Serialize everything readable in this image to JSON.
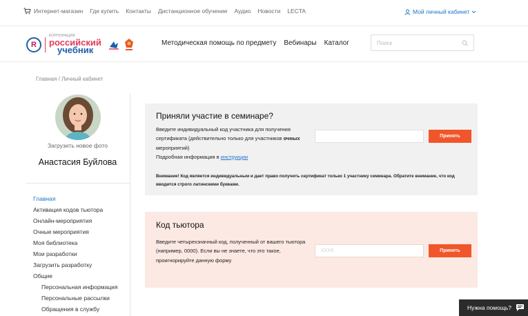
{
  "topbar": {
    "items": [
      "Интернет-магазин",
      "Где купить",
      "Контакты",
      "Дистанционное обучение",
      "Аудио",
      "Новости",
      "LECTA"
    ],
    "account_label": "Мой личный кабинет"
  },
  "logo": {
    "line1": "КОРПОРАЦИЯ",
    "line2": "российский",
    "line3": "учебник",
    "circle_letter": "R"
  },
  "mainnav": [
    "Методическая помощь по предмету",
    "Вебинары",
    "Каталог"
  ],
  "search": {
    "placeholder": "Поиск"
  },
  "breadcrumb": "Главная / Личный кабинет",
  "profile": {
    "upload_label": "Загрузить новое фото",
    "name": "Анастасия Буйлова"
  },
  "menu": [
    {
      "label": "Главная",
      "active": true,
      "sub": false
    },
    {
      "label": "Активация кодов тьютора",
      "active": false,
      "sub": false
    },
    {
      "label": "Онлайн-мероприятия",
      "active": false,
      "sub": false
    },
    {
      "label": "Очные мероприятия",
      "active": false,
      "sub": false
    },
    {
      "label": "Моя библиотека",
      "active": false,
      "sub": false
    },
    {
      "label": "Мои разработки",
      "active": false,
      "sub": false
    },
    {
      "label": "Загрузить разработку",
      "active": false,
      "sub": false
    },
    {
      "label": "Общие",
      "active": false,
      "sub": false
    },
    {
      "label": "Персональная информация",
      "active": false,
      "sub": true
    },
    {
      "label": "Персональные рассылки",
      "active": false,
      "sub": true
    },
    {
      "label": "Обращения в службу",
      "active": false,
      "sub": true
    }
  ],
  "seminar": {
    "title": "Приняли участие в семинаре?",
    "desc_part1": "Введите индивидуальный код участника для получения сертификата (действительно только для участников",
    "desc_bold": "очных",
    "desc_part2": "мероприятий)",
    "more_prefix": "Подробная информация в",
    "more_link": "инструкции",
    "button": "Принять",
    "warning": "Внимание! Код является индивидуальным и дает право получить сертификат только 1 участнику семинара. Обратите внимание, что код вводится строго латинскими буквами."
  },
  "tutor": {
    "title": "Код тьютора",
    "desc": "Введите четырехзначный код, полученный от вашего тьютора (например, 0000). Если вы не знаете, что это такое, проигнорируйте данную форму",
    "placeholder": "XXXX",
    "button": "Принять"
  },
  "help": {
    "label": "Нужна помощь?"
  },
  "colors": {
    "accent_blue": "#1d72c8",
    "button_orange": "#f0562a",
    "card_gray": "#f1f1f1",
    "card_pink": "#fce9e3"
  }
}
